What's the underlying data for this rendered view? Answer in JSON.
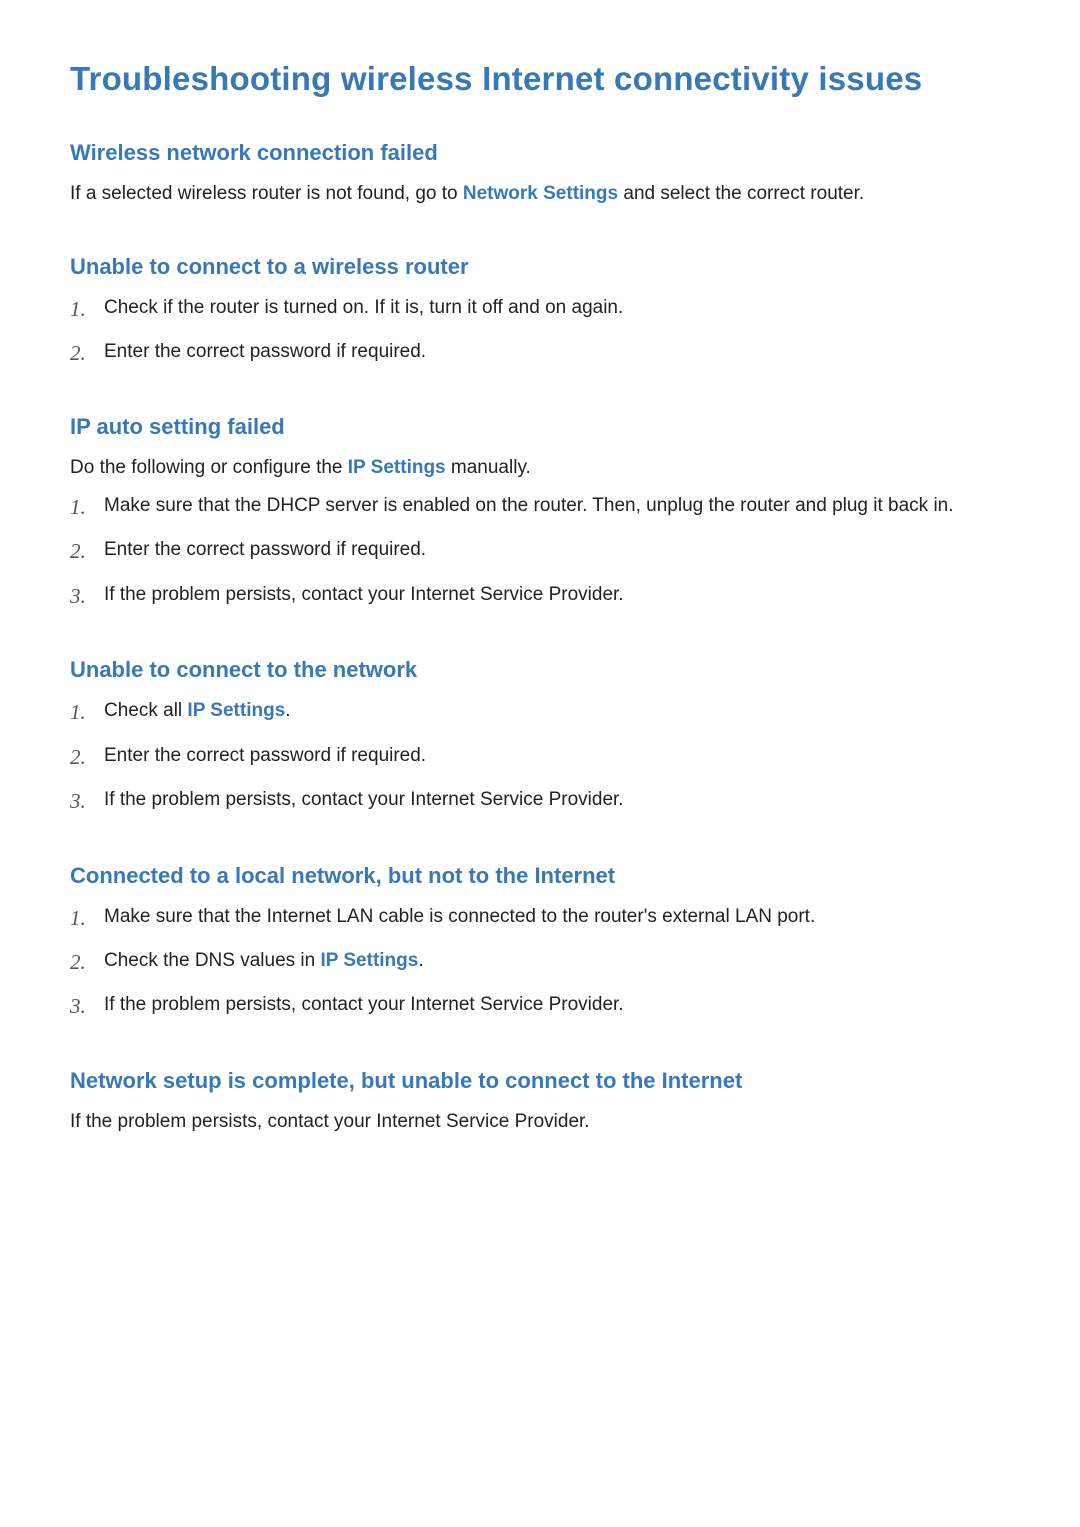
{
  "title": "Troubleshooting wireless Internet connectivity issues",
  "links": {
    "network_settings": "Network Settings",
    "ip_settings": "IP Settings"
  },
  "sections": {
    "s1": {
      "heading": "Wireless network connection failed",
      "para_pre": "If a selected wireless router is not found, go to ",
      "para_post": " and select the correct router."
    },
    "s2": {
      "heading": "Unable to connect to a wireless router",
      "items": [
        "Check if the router is turned on. If it is, turn it off and on again.",
        "Enter the correct password if required."
      ]
    },
    "s3": {
      "heading": "IP auto setting failed",
      "intro_pre": "Do the following or configure the ",
      "intro_post": " manually.",
      "items": [
        "Make sure that the DHCP server is enabled on the router. Then, unplug the router and plug it back in.",
        "Enter the correct password if required.",
        "If the problem persists, contact your Internet Service Provider."
      ]
    },
    "s4": {
      "heading": "Unable to connect to the network",
      "item1_pre": "Check all ",
      "item1_post": ".",
      "items_rest": [
        "Enter the correct password if required.",
        "If the problem persists, contact your Internet Service Provider."
      ]
    },
    "s5": {
      "heading": "Connected to a local network, but not to the Internet",
      "item1": "Make sure that the Internet LAN cable is connected to the router's external LAN port.",
      "item2_pre": "Check the DNS values in ",
      "item2_post": ".",
      "item3": "If the problem persists, contact your Internet Service Provider."
    },
    "s6": {
      "heading": "Network setup is complete, but unable to connect to the Internet",
      "para": "If the problem persists, contact your Internet Service Provider."
    }
  },
  "numbers": {
    "n1": "1.",
    "n2": "2.",
    "n3": "3."
  }
}
